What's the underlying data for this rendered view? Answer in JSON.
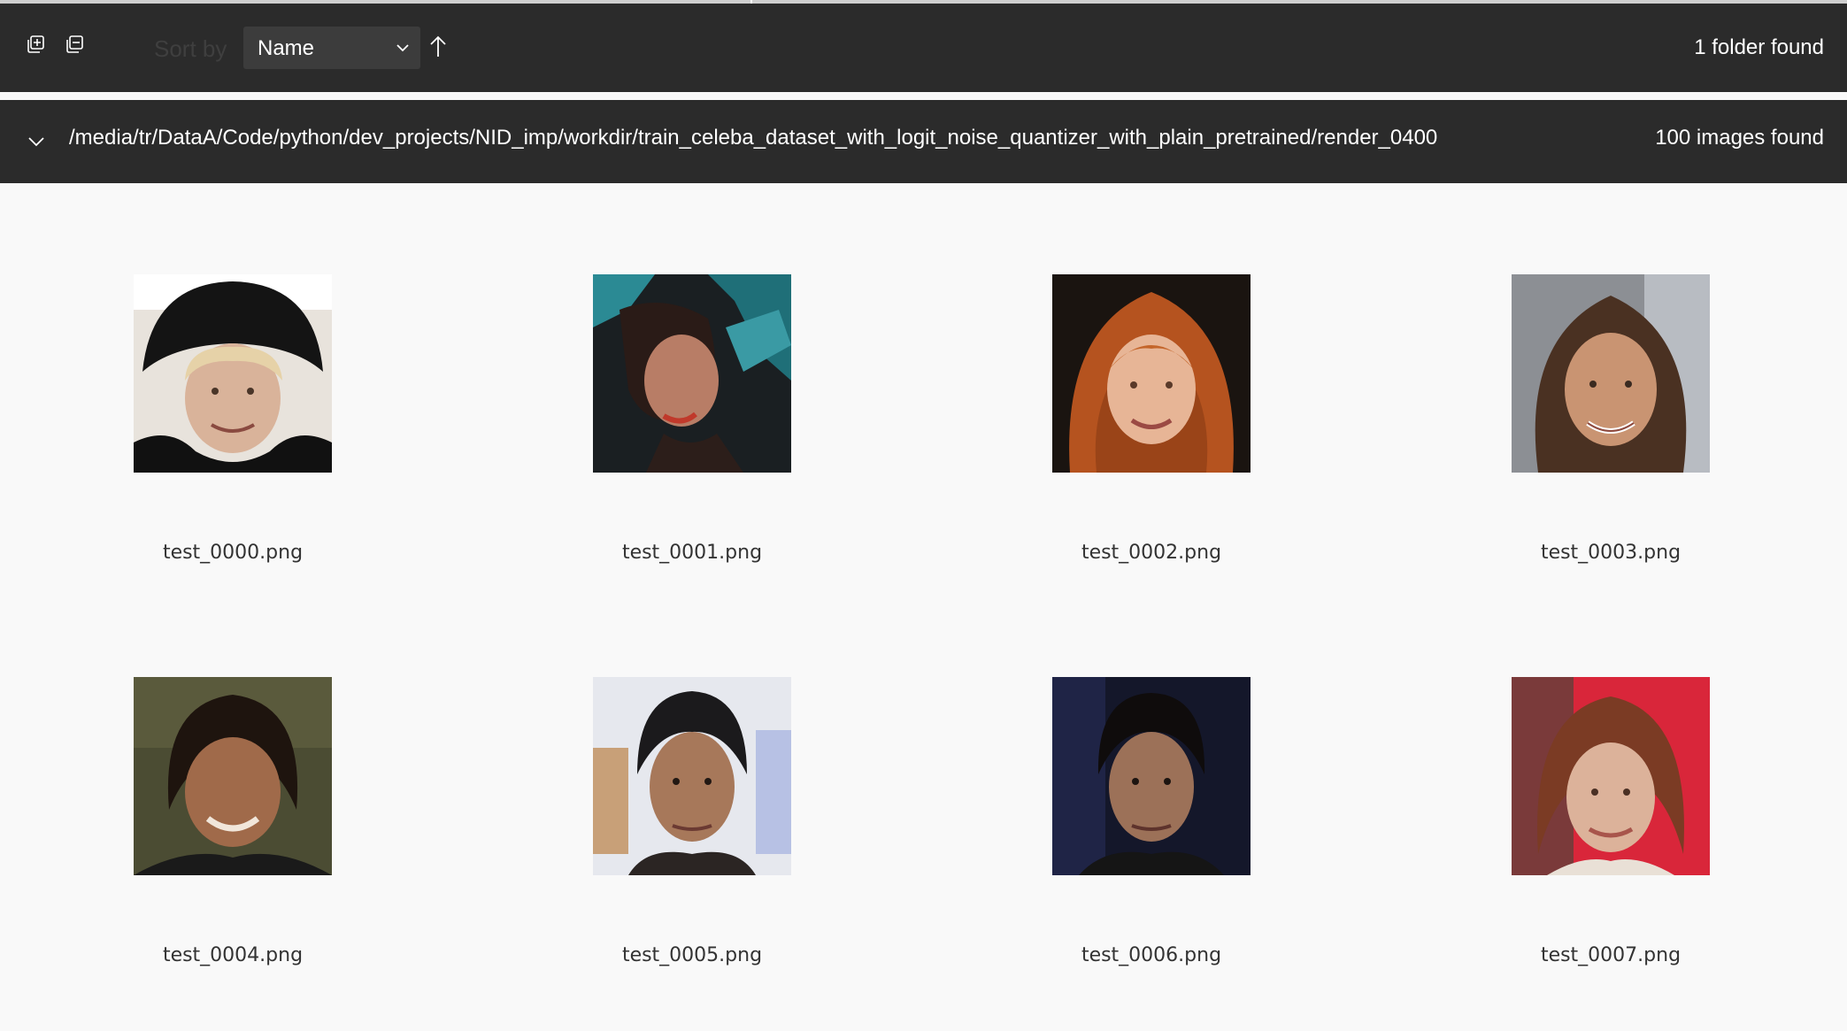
{
  "toolbar": {
    "expand_all_icon": "expand-all-icon",
    "collapse_all_icon": "collapse-all-icon",
    "sort_label": "Sort by",
    "sort_value": "Name",
    "sort_direction_icon": "arrow-up-icon",
    "folders_found": "1 folder found"
  },
  "folder": {
    "path": "/media/tr/DataA/Code/python/dev_projects/NID_imp/workdir/train_celeba_dataset_with_logit_noise_quantizer_with_plain_pretrained/render_0400",
    "images_found": "100 images found"
  },
  "images": [
    {
      "filename": "test_0000.png"
    },
    {
      "filename": "test_0001.png"
    },
    {
      "filename": "test_0002.png"
    },
    {
      "filename": "test_0003.png"
    },
    {
      "filename": "test_0004.png"
    },
    {
      "filename": "test_0005.png"
    },
    {
      "filename": "test_0006.png"
    },
    {
      "filename": "test_0007.png"
    }
  ],
  "colors": {
    "toolbar_bg": "#2b2b2b",
    "page_bg": "#f9f9f9",
    "select_bg": "#3c3c3c",
    "text_light": "#ffffff",
    "caption_text": "#333333"
  }
}
